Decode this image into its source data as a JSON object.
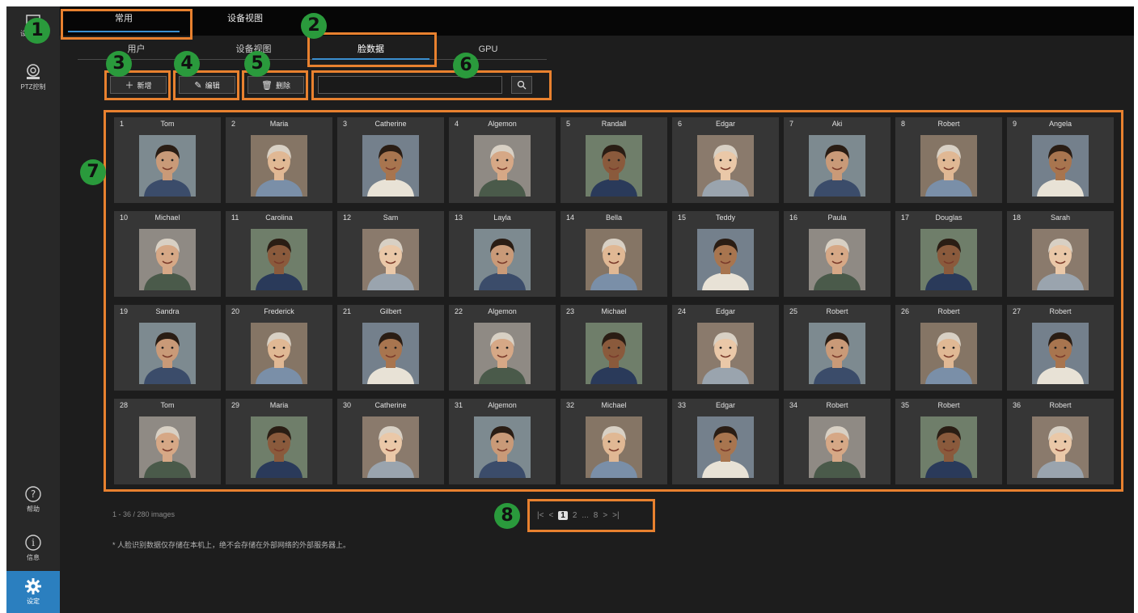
{
  "sidebar": {
    "items": [
      {
        "label": "设备视图",
        "icon": "monitor-icon"
      },
      {
        "label": "PTZ控制",
        "icon": "camera-icon"
      },
      {
        "label": "帮助",
        "icon": "help-icon"
      },
      {
        "label": "信息",
        "icon": "info-icon"
      },
      {
        "label": "设定",
        "icon": "gear-icon"
      }
    ]
  },
  "top_tabs": [
    {
      "label": "常用",
      "active": true
    },
    {
      "label": "设备视图",
      "active": false
    }
  ],
  "sub_tabs": [
    {
      "label": "用户"
    },
    {
      "label": "设备视图"
    },
    {
      "label": "脸数据",
      "active": true
    },
    {
      "label": "GPU"
    }
  ],
  "toolbar": {
    "add_label": "新增",
    "edit_label": "编辑",
    "delete_label": "删除",
    "search_placeholder": ""
  },
  "faces": [
    {
      "num": "1",
      "name": "Tom"
    },
    {
      "num": "2",
      "name": "Maria"
    },
    {
      "num": "3",
      "name": "Catherine"
    },
    {
      "num": "4",
      "name": "Algemon"
    },
    {
      "num": "5",
      "name": "Randall"
    },
    {
      "num": "6",
      "name": "Edgar"
    },
    {
      "num": "7",
      "name": "Aki"
    },
    {
      "num": "8",
      "name": "Robert"
    },
    {
      "num": "9",
      "name": "Angela"
    },
    {
      "num": "10",
      "name": "Michael"
    },
    {
      "num": "11",
      "name": "Carolina"
    },
    {
      "num": "12",
      "name": "Sam"
    },
    {
      "num": "13",
      "name": "Layla"
    },
    {
      "num": "14",
      "name": "Bella"
    },
    {
      "num": "15",
      "name": "Teddy"
    },
    {
      "num": "16",
      "name": "Paula"
    },
    {
      "num": "17",
      "name": "Douglas"
    },
    {
      "num": "18",
      "name": "Sarah"
    },
    {
      "num": "19",
      "name": "Sandra"
    },
    {
      "num": "20",
      "name": "Frederick"
    },
    {
      "num": "21",
      "name": "Gilbert"
    },
    {
      "num": "22",
      "name": "Algemon"
    },
    {
      "num": "23",
      "name": "Michael"
    },
    {
      "num": "24",
      "name": "Edgar"
    },
    {
      "num": "25",
      "name": "Robert"
    },
    {
      "num": "26",
      "name": "Robert"
    },
    {
      "num": "27",
      "name": "Robert"
    },
    {
      "num": "28",
      "name": "Tom"
    },
    {
      "num": "29",
      "name": "Maria"
    },
    {
      "num": "30",
      "name": "Catherine"
    },
    {
      "num": "31",
      "name": "Algemon"
    },
    {
      "num": "32",
      "name": "Michael"
    },
    {
      "num": "33",
      "name": "Edgar"
    },
    {
      "num": "34",
      "name": "Robert"
    },
    {
      "num": "35",
      "name": "Robert"
    },
    {
      "num": "36",
      "name": "Robert"
    }
  ],
  "footer": {
    "count_text": "1 - 36 / 280 images",
    "note_text": "* 人脸识别数据仅存储在本机上，绝不会存储在外部网络的外部服务器上。"
  },
  "pagination": {
    "first": "|<",
    "prev": "<",
    "current": "1",
    "next_page": "2",
    "ellipsis": "...",
    "last_page": "8",
    "next": ">",
    "last": ">|"
  },
  "annotations": [
    "1",
    "2",
    "3",
    "4",
    "5",
    "6",
    "7",
    "8"
  ],
  "colors": {
    "accent": "#3a8fd0",
    "highlight": "#e8812f",
    "badge": "#2a9a3c",
    "background": "#1d1d1d",
    "card": "#363636"
  }
}
